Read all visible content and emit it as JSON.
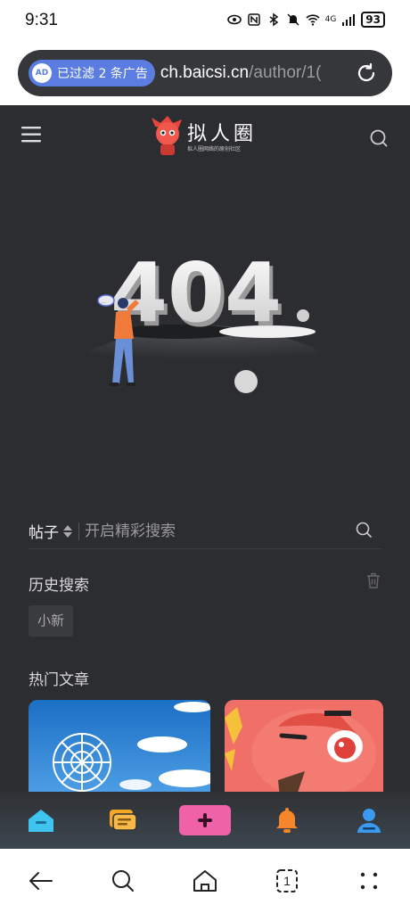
{
  "status": {
    "time": "9:31",
    "battery": "93",
    "network": "4G"
  },
  "address_bar": {
    "ad_badge": "已过滤 2 条广告",
    "url_host": "ch.baicsi.cn",
    "url_path": "/author/1("
  },
  "site": {
    "brand": "拟人圈",
    "slogan": "拟人圈网络的原创社区"
  },
  "error_code": "404",
  "search": {
    "type_label": "帖子",
    "placeholder": "开启精彩搜索"
  },
  "history": {
    "title": "历史搜索",
    "items": [
      "小新"
    ]
  },
  "hot": {
    "title": "热门文章"
  },
  "tabs": [
    {
      "name": "home",
      "icon": "home-icon",
      "color": "#3fc4f0"
    },
    {
      "name": "messages",
      "icon": "chat-icon",
      "color": "#f5a623"
    },
    {
      "name": "post",
      "icon": "plus-icon",
      "color": "#f062a8"
    },
    {
      "name": "notifications",
      "icon": "bell-icon",
      "color": "#f5862a"
    },
    {
      "name": "profile",
      "icon": "user-icon",
      "color": "#3a9af0"
    }
  ],
  "system_nav": {
    "tabs_count": "1"
  }
}
